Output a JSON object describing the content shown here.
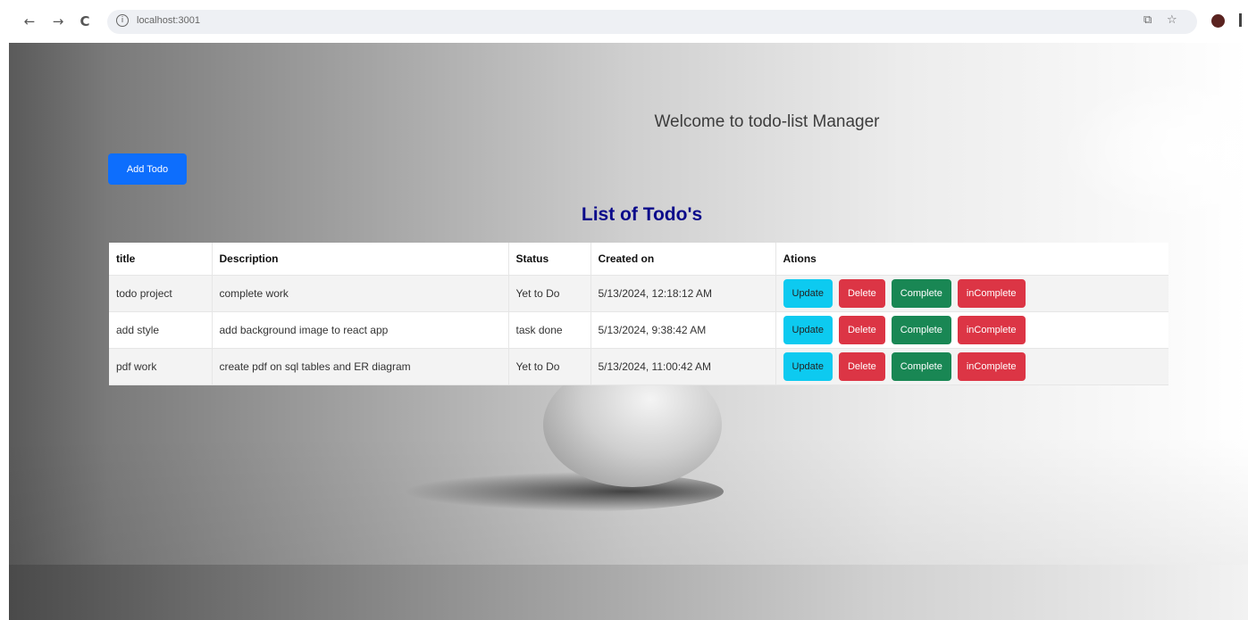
{
  "browser": {
    "url": "localhost:3001",
    "back_icon": "←",
    "forward_icon": "→",
    "reload_icon": "C",
    "info_icon": "i",
    "cast_icon": "⧉",
    "star_icon": "☆"
  },
  "page": {
    "welcome": "Welcome to todo-list Manager",
    "add_button": "Add Todo",
    "list_title": "List of Todo's"
  },
  "table": {
    "headers": [
      "title",
      "Description",
      "Status",
      "Created on",
      "Ations"
    ],
    "rows": [
      {
        "title": "todo project",
        "description": "complete work",
        "status": "Yet to Do",
        "created": "5/13/2024, 12:18:12 AM"
      },
      {
        "title": "add style",
        "description": "add background image to react app",
        "status": "task done",
        "created": "5/13/2024, 9:38:42 AM"
      },
      {
        "title": "pdf work",
        "description": "create pdf on sql tables and ER diagram",
        "status": "Yet to Do",
        "created": "5/13/2024, 11:00:42 AM"
      }
    ],
    "actions": {
      "update": "Update",
      "delete": "Delete",
      "complete": "Complete",
      "incomplete": "inComplete"
    }
  },
  "colors": {
    "primary": "#0d6efd",
    "info": "#0dcaf0",
    "danger": "#dc3545",
    "success": "#198754",
    "title": "#0a0a8a"
  }
}
